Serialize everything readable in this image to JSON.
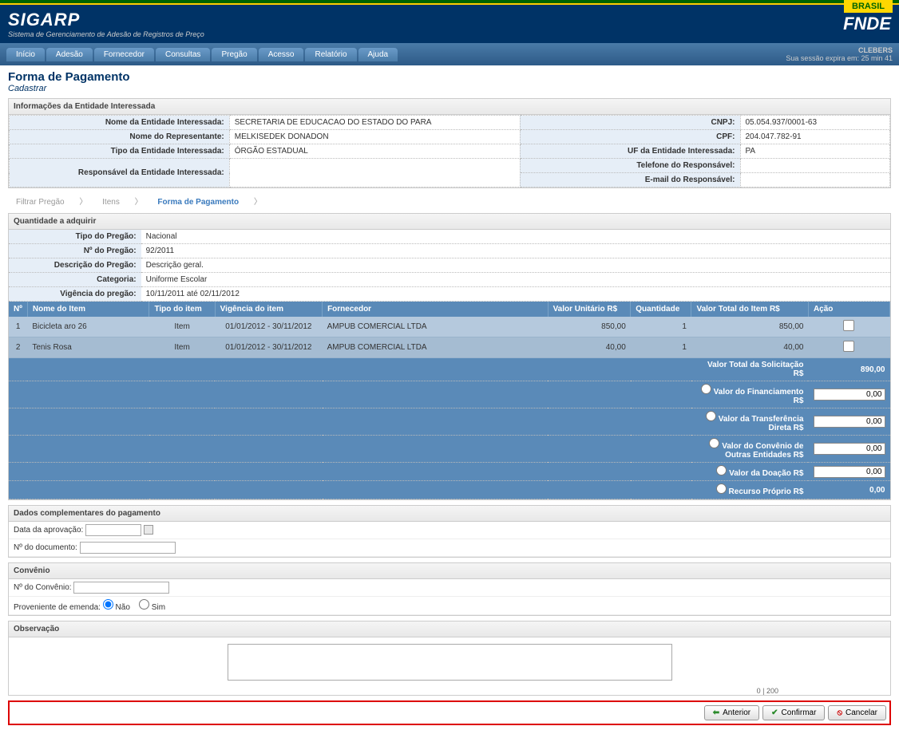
{
  "top": {
    "brasil": "BRASIL"
  },
  "header": {
    "app": "SIGARP",
    "sub": "Sistema de Gerenciamento de Adesão de Registros de Preço",
    "org": "FNDE"
  },
  "nav": {
    "items": [
      "Início",
      "Adesão",
      "Fornecedor",
      "Consultas",
      "Pregão",
      "Acesso",
      "Relatório",
      "Ajuda"
    ],
    "user": "CLEBERS",
    "session": "Sua sessão expira em: 25 min 41"
  },
  "page": {
    "title": "Forma de Pagamento",
    "sub": "Cadastrar"
  },
  "info": {
    "header": "Informações da Entidade Interessada",
    "l_nome_ent": "Nome da Entidade Interessada:",
    "v_nome_ent": "SECRETARIA DE EDUCACAO DO ESTADO DO PARA",
    "l_cnpj": "CNPJ:",
    "v_cnpj": "05.054.937/0001-63",
    "l_nome_rep": "Nome do Representante:",
    "v_nome_rep": "MELKISEDEK DONADON",
    "l_cpf": "CPF:",
    "v_cpf": "204.047.782-91",
    "l_tipo": "Tipo da Entidade Interessada:",
    "v_tipo": "ÓRGÃO ESTADUAL",
    "l_uf": "UF da Entidade Interessada:",
    "v_uf": "PA",
    "l_resp": "Responsável da Entidade Interessada:",
    "v_resp": "",
    "l_tel": "Telefone do Responsável:",
    "v_tel": "",
    "l_email": "E-mail do Responsável:",
    "v_email": ""
  },
  "bc": {
    "a": "Filtrar Pregão",
    "b": "Itens",
    "c": "Forma de Pagamento"
  },
  "qty": {
    "header": "Quantidade a adquirir",
    "l_tipo": "Tipo do Pregão:",
    "v_tipo": "Nacional",
    "l_num": "Nº do Pregão:",
    "v_num": "92/2011",
    "l_desc": "Descrição do Pregão:",
    "v_desc": "Descrição geral.",
    "l_cat": "Categoria:",
    "v_cat": "Uniforme Escolar",
    "l_vig": "Vigência do pregão:",
    "v_vig": "10/11/2011 até 02/11/2012"
  },
  "cols": {
    "n": "Nº",
    "nome": "Nome do Item",
    "tipo": "Tipo do item",
    "vig": "Vigência do item",
    "forn": "Fornecedor",
    "vu": "Valor Unitário R$",
    "qt": "Quantidade",
    "vt": "Valor Total do Item R$",
    "ac": "Ação"
  },
  "rows": [
    {
      "n": "1",
      "nome": "Bicicleta aro 26",
      "tipo": "Item",
      "vig": "01/01/2012 - 30/11/2012",
      "forn": "AMPUB COMERCIAL LTDA",
      "vu": "850,00",
      "qt": "1",
      "vt": "850,00"
    },
    {
      "n": "2",
      "nome": "Tenis Rosa",
      "tipo": "Item",
      "vig": "01/01/2012 - 30/11/2012",
      "forn": "AMPUB COMERCIAL LTDA",
      "vu": "40,00",
      "qt": "1",
      "vt": "40,00"
    }
  ],
  "tot": {
    "l_solic": "Valor Total da Solicitação R$",
    "v_solic": "890,00",
    "l_fin": "Valor do Financiamento R$",
    "v_fin": "0,00",
    "l_trans": "Valor da Transferência Direta R$",
    "v_trans": "0,00",
    "l_conv": "Valor do Convênio de Outras Entidades R$",
    "v_conv": "0,00",
    "l_doa": "Valor da Doação R$",
    "v_doa": "0,00",
    "l_rec": "Recurso Próprio R$",
    "v_rec": "0,00"
  },
  "comp": {
    "header": "Dados complementares do pagamento",
    "l_data": "Data da aprovação:",
    "l_doc": "Nº do documento:"
  },
  "conv": {
    "header": "Convênio",
    "l_num": "Nº do Convênio:",
    "l_emen": "Proveniente de emenda:",
    "nao": "Não",
    "sim": "Sim"
  },
  "obs": {
    "header": "Observação",
    "count": "0 | 200"
  },
  "btns": {
    "ant": "Anterior",
    "conf": "Confirmar",
    "canc": "Cancelar"
  }
}
